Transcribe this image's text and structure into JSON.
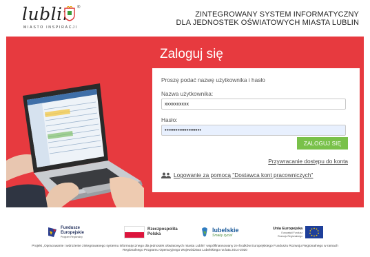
{
  "header": {
    "logo_word": "lublin",
    "logo_tagline": "MIASTO INSPIRACJI",
    "logo_reg": "®",
    "title_line1": "ZINTEGROWANY SYSTEM INFORMATYCZNY",
    "title_line2": "DLA JEDNOSTEK OŚWIATOWYCH MIASTA LUBLIN"
  },
  "login": {
    "heading": "Zaloguj się",
    "prompt": "Proszę podać nazwę użytkownika i hasło",
    "username_label": "Nazwa użytkownika:",
    "username_value": "xxxxxxxxxx",
    "password_label": "Hasło:",
    "password_value": "••••••••••••••••••••",
    "submit_label": "ZALOGUJ SIĘ",
    "reset_link": "Przywracanie dostępu do konta",
    "provider_link": "Logowanie za pomocą \"Dostawca kont pracowniczych\""
  },
  "footer": {
    "fe_line1": "Fundusze",
    "fe_line2": "Europejskie",
    "fe_line3": "Program Regionalny",
    "rp_line1": "Rzeczpospolita",
    "rp_line2": "Polska",
    "lubelskie": "lubelskie",
    "lubelskie_sub": "Smaky życia!",
    "ue_line1": "Unia Europejska",
    "ue_line2": "Europejski Fundusz",
    "ue_line3": "Rozwoju Regionalnego",
    "project_note": "Projekt „Opracowanie i wdrożenie zintegrowanego systemu informatycznego dla jednostek oświatowych miasta Lublin” współfinansowany ze środków Europejskiego Funduszu Rozwoju Regionalnego w ramach Regionalnego Programu Operacyjnego Województwa Lubelskiego na lata 2014-2020"
  },
  "colors": {
    "band_red": "#e73a3f",
    "button_green": "#79c14a",
    "eu_blue": "#1e3f9a",
    "pl_red": "#dc143c"
  }
}
